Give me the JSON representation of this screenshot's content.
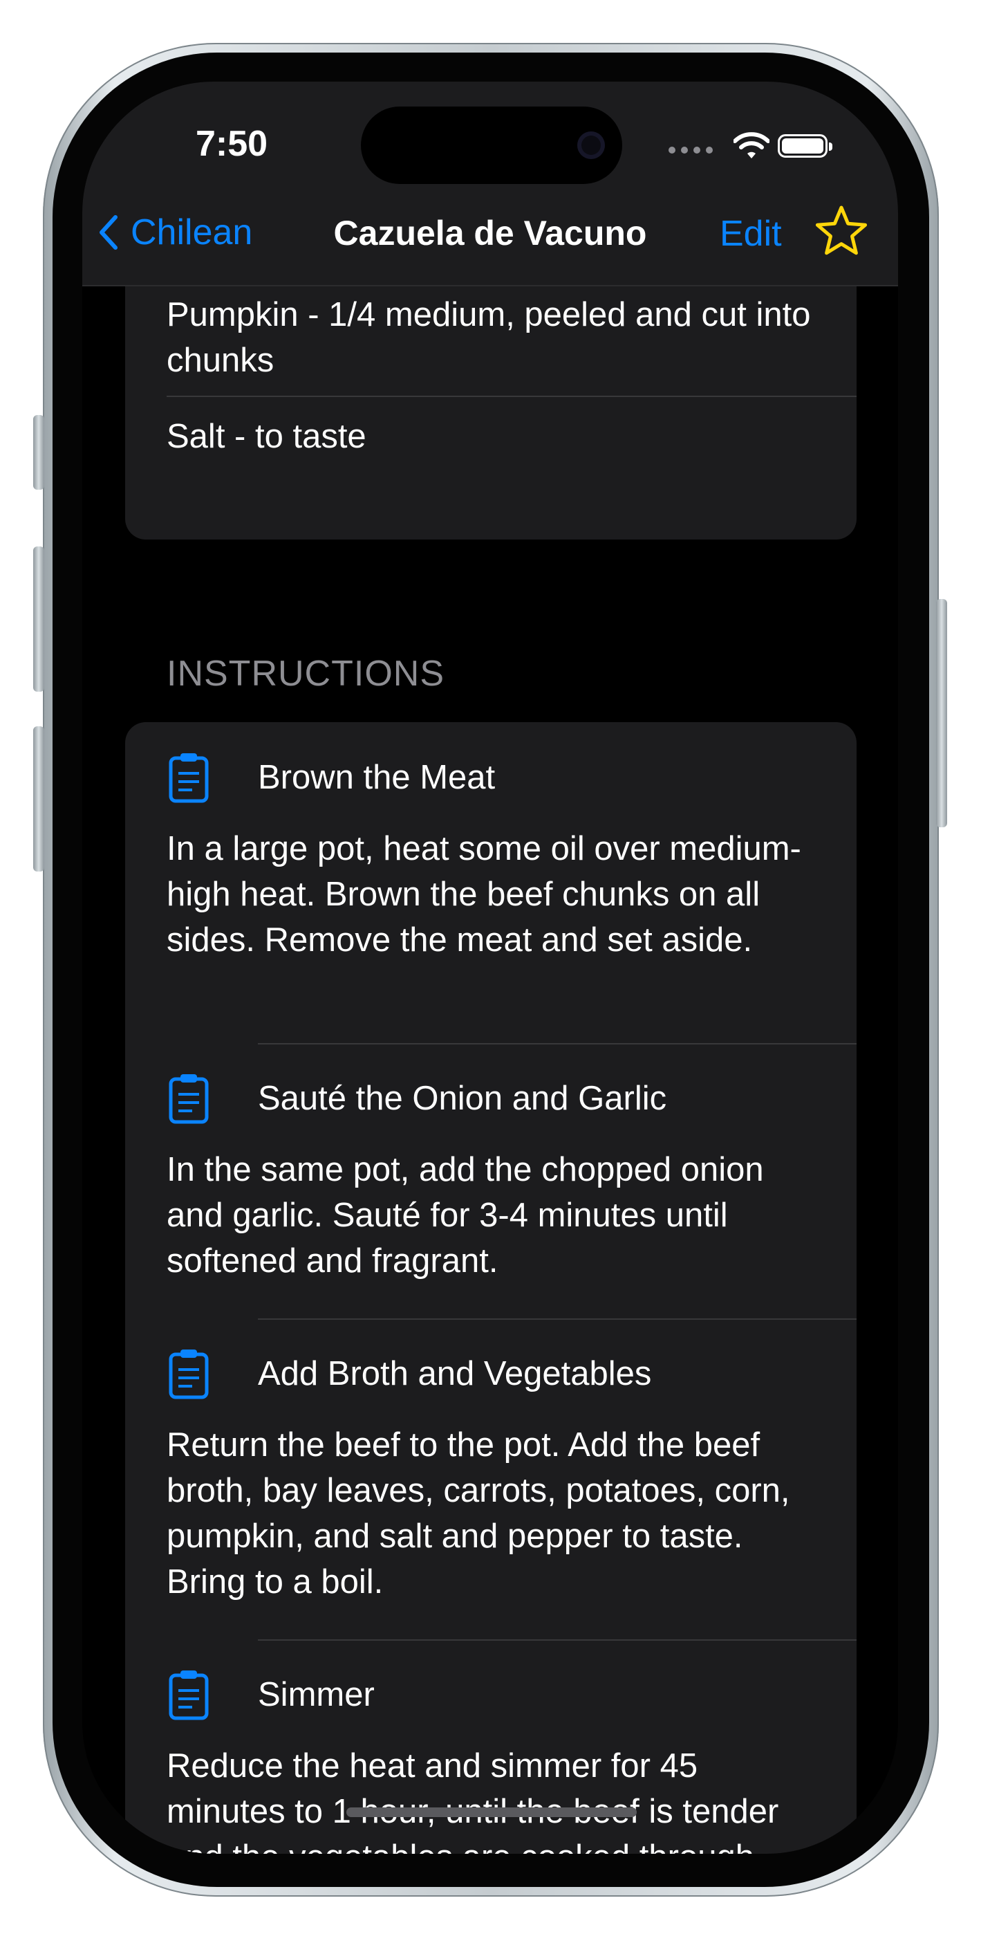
{
  "status_bar": {
    "time": "7:50"
  },
  "nav": {
    "back_label": "Chilean",
    "title": "Cazuela de Vacuno",
    "edit_label": "Edit",
    "star_color": "#ffd60a"
  },
  "ingredients": [
    {
      "text": "Pumpkin - 1/4 medium, peeled and cut into chunks"
    },
    {
      "text": "Salt - to taste"
    }
  ],
  "instructions": {
    "header": "INSTRUCTIONS",
    "steps": [
      {
        "icon": "clipboard-icon",
        "title": "Brown the Meat",
        "body": "In a large pot, heat some oil over medium-high heat. Brown the beef chunks on all sides. Remove the meat and set aside."
      },
      {
        "icon": "clipboard-icon",
        "title": "Sauté the Onion and Garlic",
        "body": "In the same pot, add the chopped onion and garlic. Sauté for 3-4 minutes until softened and fragrant."
      },
      {
        "icon": "clipboard-icon",
        "title": "Add Broth and Vegetables",
        "body": "Return the beef to the pot. Add the beef broth, bay leaves, carrots, potatoes, corn, pumpkin, and salt and pepper to taste. Bring to a boil."
      },
      {
        "icon": "clipboard-icon",
        "title": "Simmer",
        "body": "Reduce the heat and simmer for 45 minutes to 1 hour, until the beef is tender and the vegetables are cooked through."
      }
    ]
  },
  "colors": {
    "accent": "#0a84ff",
    "background": "#000000",
    "card": "#1c1c1e",
    "separator": "#38383a"
  }
}
